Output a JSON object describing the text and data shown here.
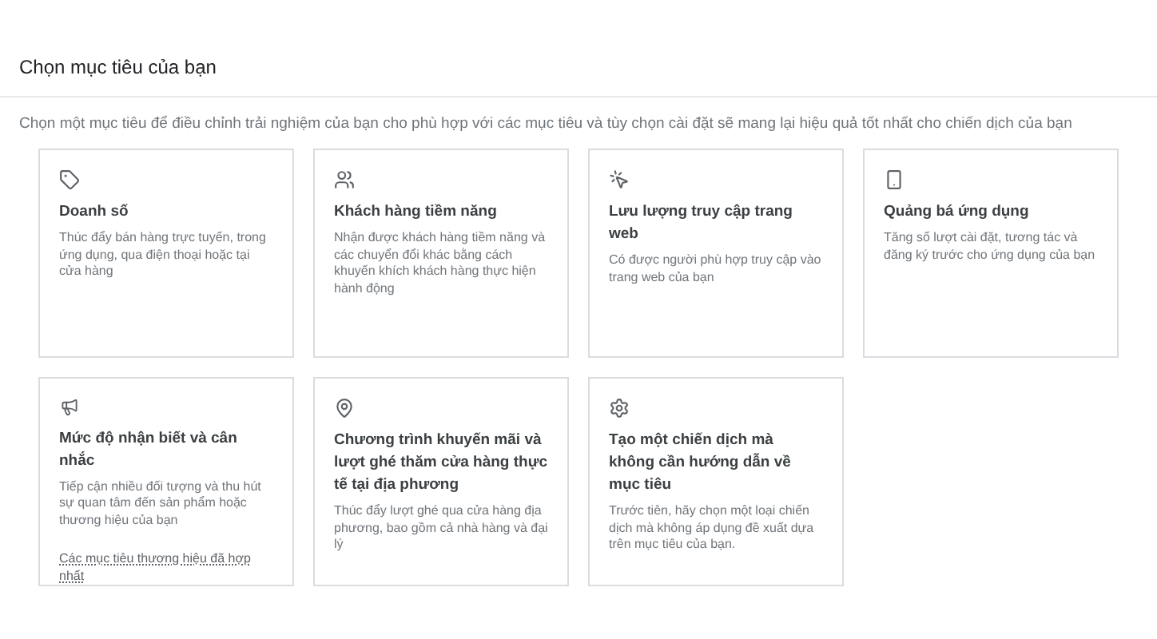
{
  "title": "Chọn mục tiêu của bạn",
  "subtitle": "Chọn một mục tiêu để điều chỉnh trải nghiệm của bạn cho phù hợp với các mục tiêu và tùy chọn cài đặt sẽ mang lại hiệu quả tốt nhất cho chiến dịch của bạn",
  "cards": [
    {
      "title": "Doanh số",
      "description": "Thúc đẩy bán hàng trực tuyến, trong ứng dụng, qua điện thoại hoặc tại cửa hàng"
    },
    {
      "title": "Khách hàng tiềm năng",
      "description": "Nhận được khách hàng tiềm năng và các chuyển đổi khác bằng cách khuyến khích khách hàng thực hiện hành động"
    },
    {
      "title": "Lưu lượng truy cập trang web",
      "description": "Có được người phù hợp truy cập vào trang web của bạn"
    },
    {
      "title": "Quảng bá ứng dụng",
      "description": "Tăng số lượt cài đặt, tương tác và đăng ký trước cho ứng dụng của bạn"
    },
    {
      "title": "Mức độ nhận biết và cân nhắc",
      "description": "Tiếp cận nhiều đối tượng và thu hút sự quan tâm đến sản phẩm hoặc thương hiệu của bạn",
      "link": "Các mục tiêu thương hiệu đã hợp nhất"
    },
    {
      "title": "Chương trình khuyến mãi và lượt ghé thăm cửa hàng thực tế tại địa phương",
      "description": "Thúc đẩy lượt ghé qua cửa hàng địa phương, bao gồm cả nhà hàng và đại lý"
    },
    {
      "title": "Tạo một chiến dịch mà không cần hướng dẫn về mục tiêu",
      "description": "Trước tiên, hãy chọn một loại chiến dịch mà không áp dụng đề xuất dựa trên mục tiêu của bạn."
    }
  ]
}
